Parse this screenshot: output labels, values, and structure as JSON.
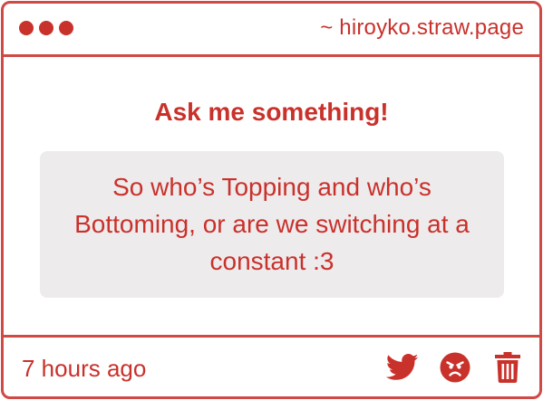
{
  "window": {
    "site": "~ hiroyko.straw.page",
    "control_dots": [
      "dot-1",
      "dot-2",
      "dot-3"
    ]
  },
  "main": {
    "heading": "Ask me something!",
    "question": "So who’s Topping and who’s Bottoming, or are we switching at a constant :3"
  },
  "footer": {
    "time": "7 hours ago",
    "actions": [
      {
        "name": "twitter-share",
        "icon": "twitter-icon"
      },
      {
        "name": "react",
        "icon": "angry-face-icon"
      },
      {
        "name": "delete",
        "icon": "trash-icon"
      }
    ]
  },
  "colors": {
    "accent": "#c9312b",
    "border": "#cf4a45",
    "question_bg": "#eeebec"
  }
}
